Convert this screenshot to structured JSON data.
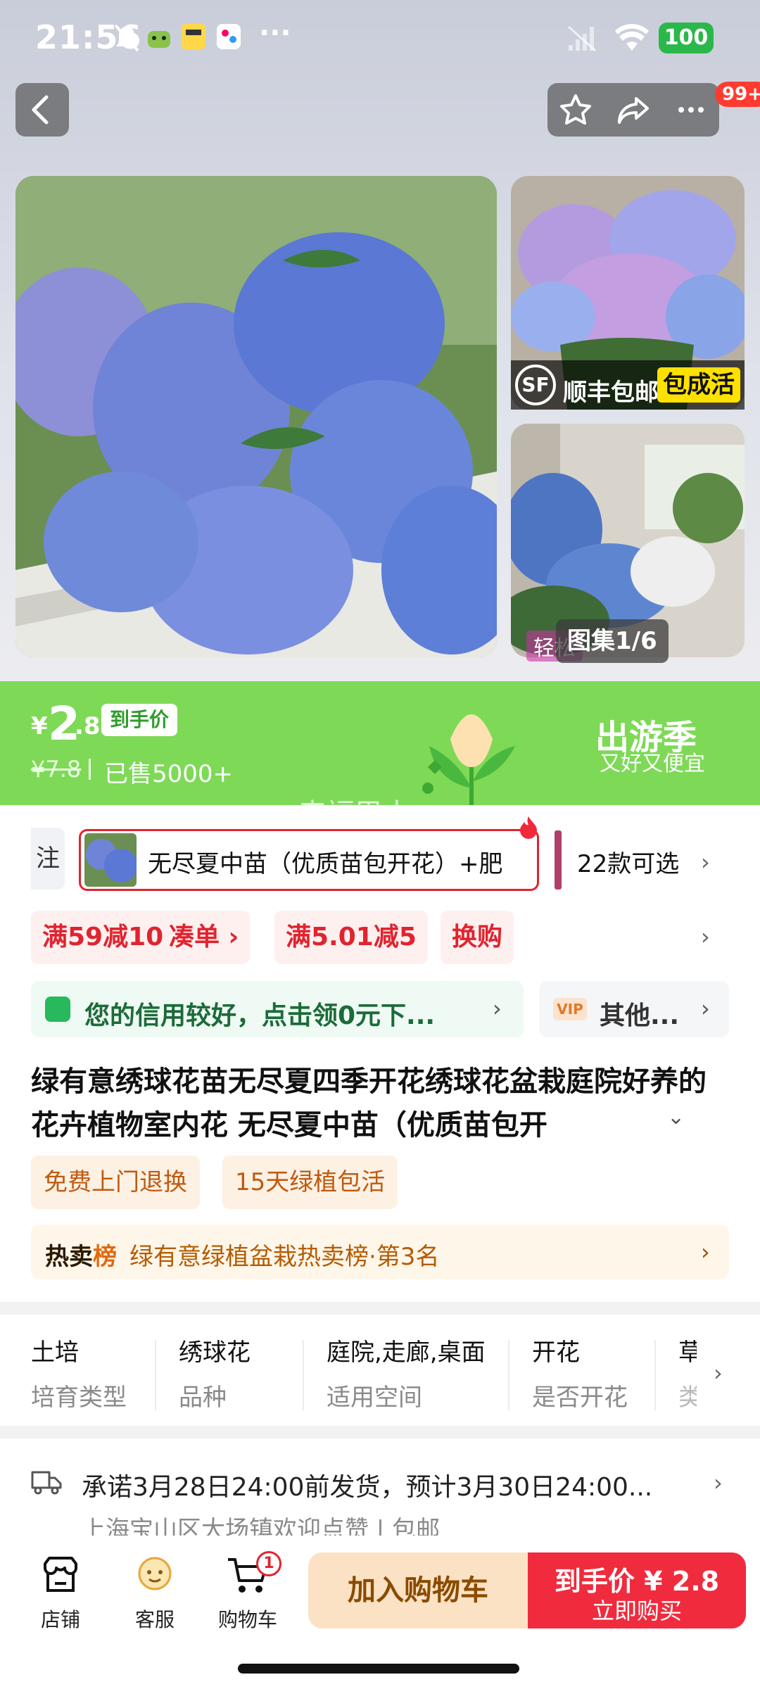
{
  "status_bar": {
    "time": "21:56",
    "more": "···",
    "battery": "100",
    "icons": [
      "mute-icon",
      "android-icon",
      "app-icon",
      "app-icon",
      "signal-icon",
      "wifi-icon"
    ]
  },
  "header": {
    "notification_count": "99+",
    "actions": [
      "favorite-icon",
      "share-icon",
      "more-icon"
    ]
  },
  "gallery": {
    "shipping_logo": "SF",
    "shipping_text": "顺丰包邮",
    "guarantee_tag": "包成活",
    "thumb2_caption": "轻松",
    "counter": "图集1/6"
  },
  "price": {
    "currency": "¥",
    "integer": "2",
    "decimal": ".8",
    "price_label": "到手价",
    "original": "¥7.8",
    "sold": "已售5000+",
    "promo_title": "出游季",
    "promo_subtitle": "又好又便宜",
    "watermark": "来福巴士"
  },
  "sku": {
    "prev_partial": "注",
    "selected_label": "无尽夏中苗（优质苗包开花）+肥",
    "count": "22款可选"
  },
  "coupons": [
    "满59减10",
    "凑单 ›",
    "满5.01减5",
    "换购"
  ],
  "credit": {
    "text": "您的信用较好，点击领0元下...",
    "vip_icon": "VIP",
    "vip_text": "其他..."
  },
  "product": {
    "title": "绿有意绣球花苗无尽夏四季开花绣球花盆栽庭院好养的花卉植物室内花 无尽夏中苗（优质苗包开",
    "expand": "⌄"
  },
  "services": [
    "免费上门退换",
    "15天绿植包活"
  ],
  "ranking": {
    "label_a": "热卖",
    "label_b": "榜",
    "text": "绿有意绿植盆栽热卖榜·第3名"
  },
  "attributes": [
    {
      "value": "土培",
      "key": "培育类型"
    },
    {
      "value": "绣球花",
      "key": "品种"
    },
    {
      "value": "庭院,走廊,桌面",
      "key": "适用空间"
    },
    {
      "value": "开花",
      "key": "是否开花"
    },
    {
      "value": "草",
      "key": "类"
    }
  ],
  "shipping": {
    "promise": "承诺3月28日24:00前发货，预计3月30日24:00...",
    "origin": "上海宝山区大场镇欢迎点赞 | 包邮"
  },
  "bottom_nav": {
    "store": "店铺",
    "service": "客服",
    "cart": "购物车",
    "cart_count": "1",
    "add_to_cart": "加入购物车",
    "buy_price": "到手价 ¥ 2.8",
    "buy_now": "立即购买"
  },
  "colors": {
    "accent_green": "#7ed957",
    "accent_red": "#f02b3e",
    "orange_text": "#c05a10"
  }
}
